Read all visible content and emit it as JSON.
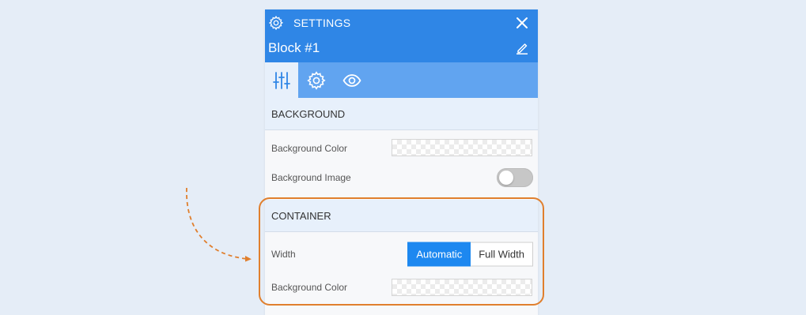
{
  "header": {
    "title": "SETTINGS",
    "block_name": "Block #1",
    "icons": {
      "settings": "gear-icon",
      "close": "close-icon",
      "edit": "pencil-icon"
    }
  },
  "tabs": [
    {
      "icon": "sliders-icon",
      "active": true
    },
    {
      "icon": "gear-icon",
      "active": false
    },
    {
      "icon": "eye-icon",
      "active": false
    }
  ],
  "background_section": {
    "title": "BACKGROUND",
    "color_label": "Background Color",
    "image_label": "Background Image",
    "image_enabled": false
  },
  "container_section": {
    "title": "CONTAINER",
    "width_label": "Width",
    "width_options": [
      "Automatic",
      "Full Width"
    ],
    "width_selected": "Automatic",
    "color_label": "Background Color"
  },
  "colors": {
    "header": "#2f86e6",
    "tabbar": "#61a4f0",
    "accent": "#1d88f0",
    "highlight": "#e07f2d",
    "page_bg": "#e5edf7"
  }
}
